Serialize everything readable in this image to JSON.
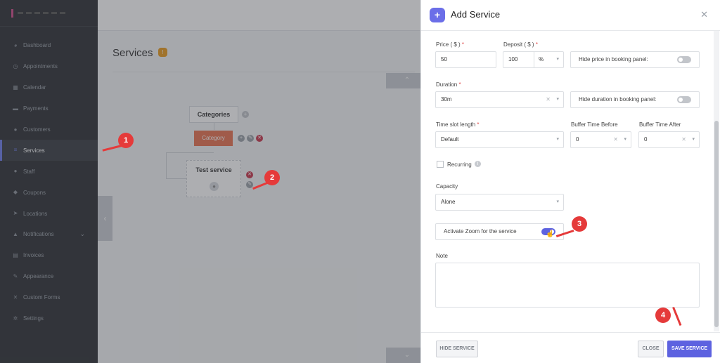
{
  "sidebar": {
    "items": [
      {
        "label": "Dashboard",
        "icon": "palette-icon"
      },
      {
        "label": "Appointments",
        "icon": "clock-icon"
      },
      {
        "label": "Calendar",
        "icon": "calendar-icon"
      },
      {
        "label": "Payments",
        "icon": "wallet-icon"
      },
      {
        "label": "Customers",
        "icon": "users-icon"
      },
      {
        "label": "Services",
        "icon": "list-icon"
      },
      {
        "label": "Staff",
        "icon": "user-icon"
      },
      {
        "label": "Coupons",
        "icon": "tag-icon"
      },
      {
        "label": "Locations",
        "icon": "location-icon"
      },
      {
        "label": "Notifications",
        "icon": "bell-icon"
      },
      {
        "label": "Invoices",
        "icon": "document-icon"
      },
      {
        "label": "Appearance",
        "icon": "brush-icon"
      },
      {
        "label": "Custom Forms",
        "icon": "wrench-icon"
      },
      {
        "label": "Settings",
        "icon": "gear-icon"
      }
    ],
    "active": "Services"
  },
  "main": {
    "title": "Services",
    "badge": "!",
    "tree": {
      "categories_label": "Categories",
      "category_button": "Category",
      "service_title": "Test service"
    }
  },
  "panel": {
    "title": "Add Service",
    "price": {
      "label": "Price ( $ )",
      "value": "50"
    },
    "deposit": {
      "label": "Deposit ( $ )",
      "value": "100",
      "unit": "%"
    },
    "hide_price": {
      "label": "Hide price in booking panel:",
      "on": false
    },
    "duration": {
      "label": "Duration",
      "value": "30m"
    },
    "hide_duration": {
      "label": "Hide duration in booking panel:",
      "on": false
    },
    "timeslot": {
      "label": "Time slot length",
      "value": "Default"
    },
    "buffer_before": {
      "label": "Buffer Time Before",
      "value": "0"
    },
    "buffer_after": {
      "label": "Buffer Time After",
      "value": "0"
    },
    "recurring": {
      "label": "Recurring",
      "checked": false
    },
    "capacity": {
      "label": "Capacity",
      "value": "Alone"
    },
    "zoom": {
      "label": "Activate Zoom for the service",
      "on": true
    },
    "note": {
      "label": "Note",
      "value": ""
    },
    "buttons": {
      "hide": "HIDE SERVICE",
      "close": "CLOSE",
      "save": "SAVE SERVICE"
    }
  },
  "callouts": [
    "1",
    "2",
    "3",
    "4"
  ],
  "colors": {
    "accent": "#5d62e0",
    "callout": "#e53a3a",
    "sidebar": "#2b2e33"
  }
}
